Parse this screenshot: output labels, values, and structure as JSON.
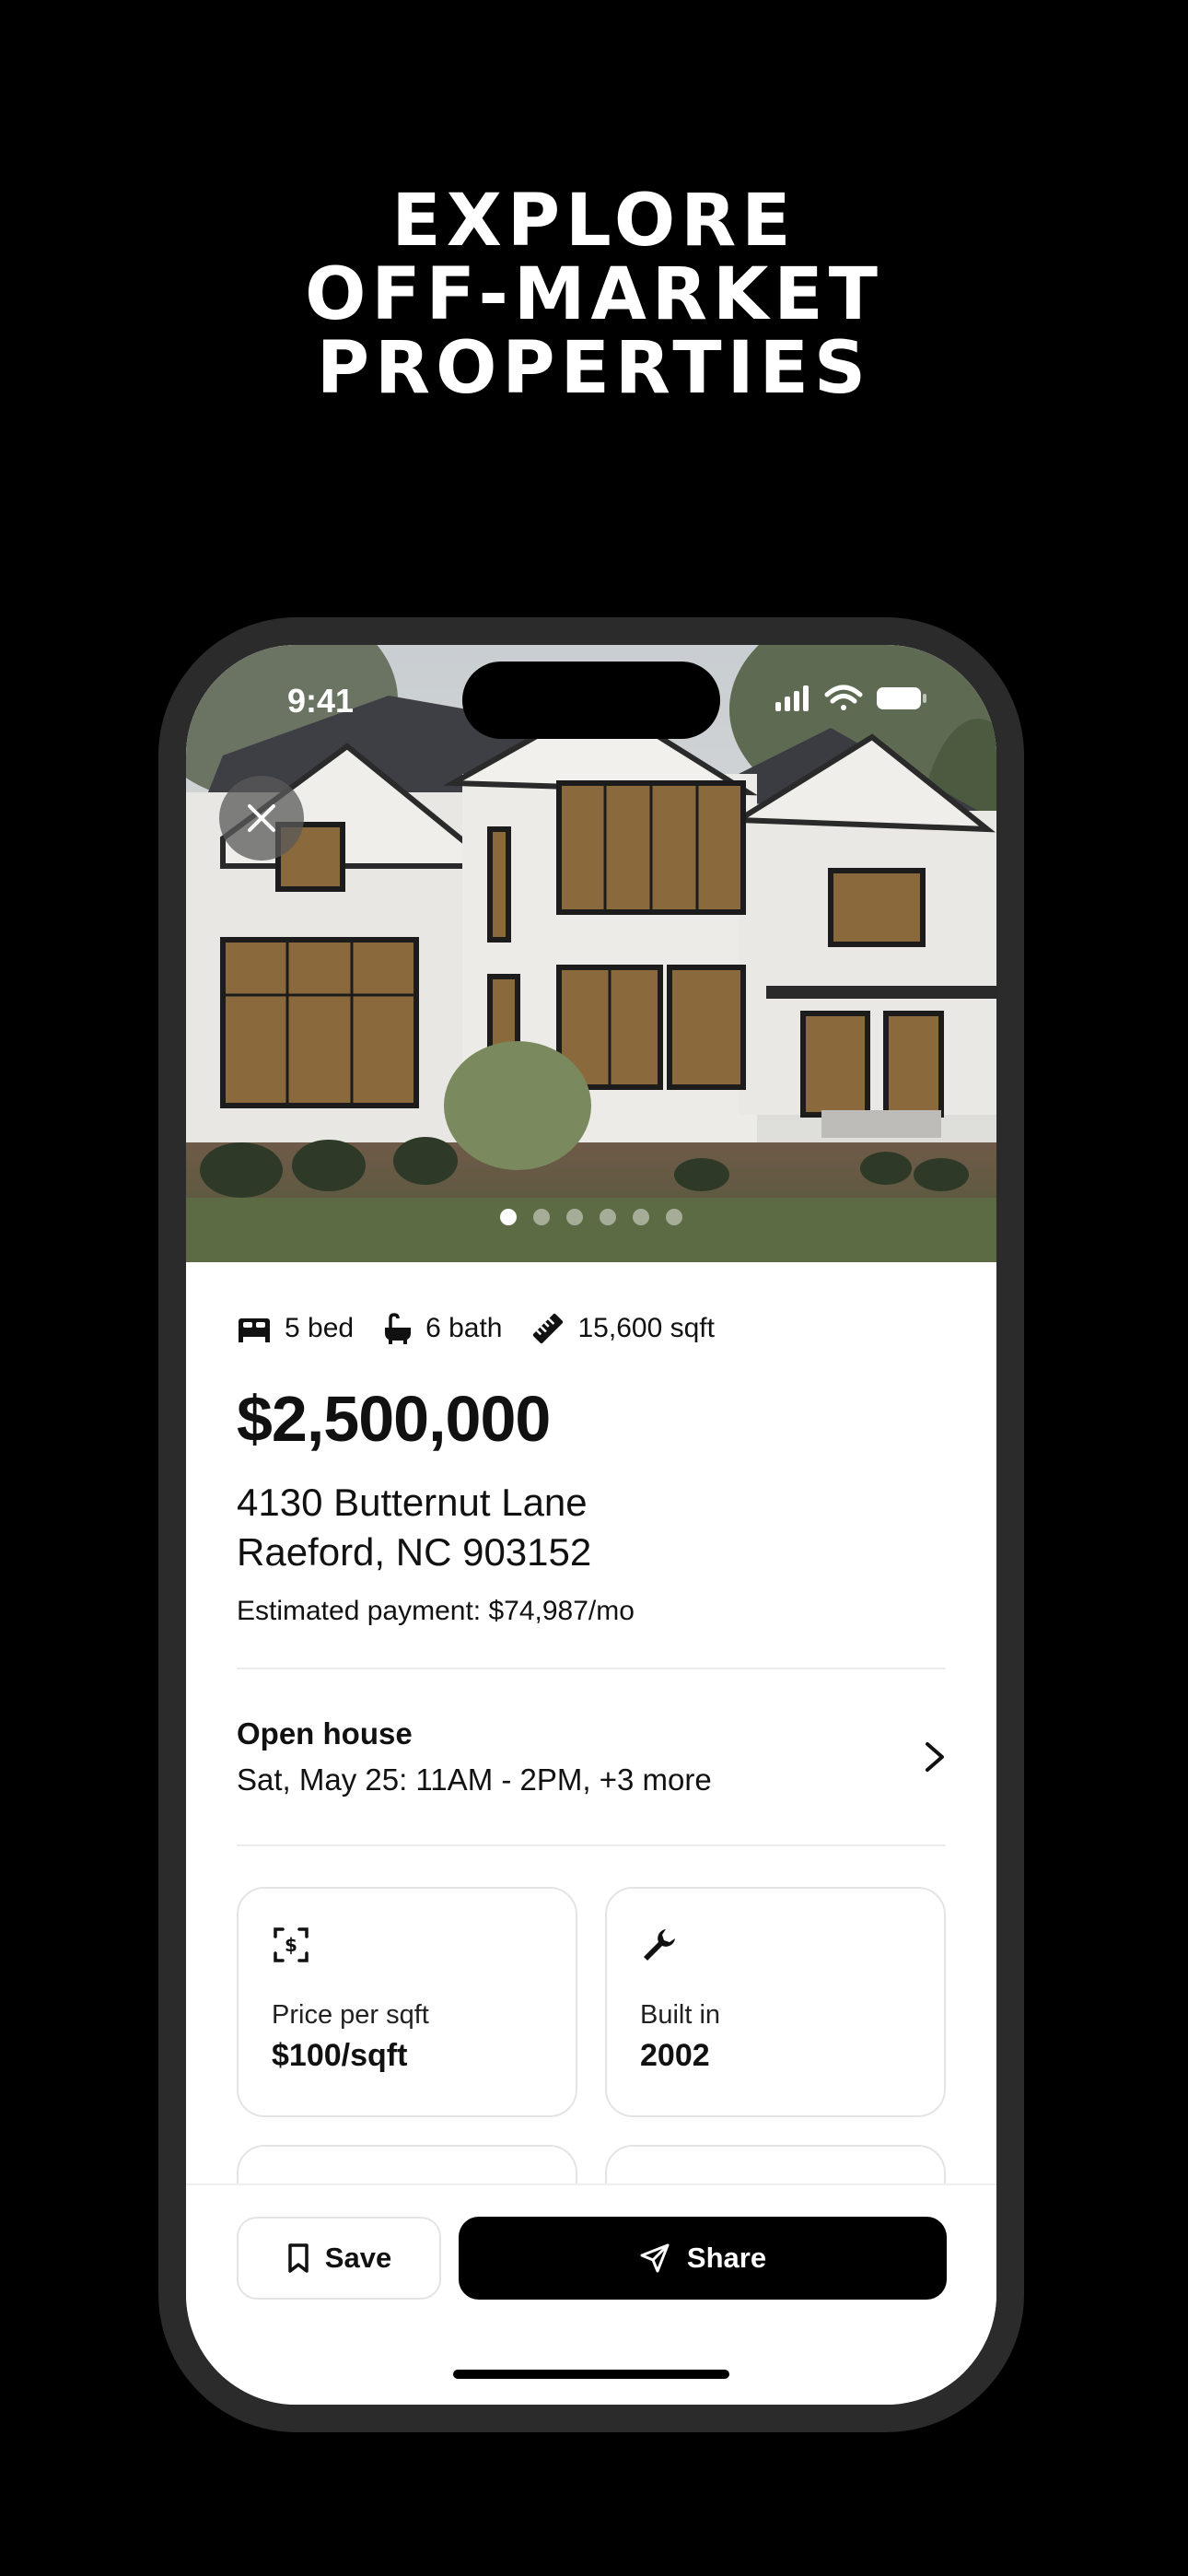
{
  "headline": {
    "line1": "EXPLORE",
    "line2": "OFF-MARKET",
    "line3": "PROPERTIES"
  },
  "status_bar": {
    "time": "9:41"
  },
  "gallery": {
    "photo_count": 6,
    "active_index": 0
  },
  "listing": {
    "beds": "5 bed",
    "baths": "6 bath",
    "sqft": "15,600 sqft",
    "price": "$2,500,000",
    "address_line1": "4130 Butternut Lane",
    "address_line2": "Raeford, NC 903152",
    "estimated_payment": "Estimated payment: $74,987/mo"
  },
  "open_house": {
    "title": "Open house",
    "schedule": "Sat, May 25: 11AM - 2PM, +3 more"
  },
  "facts": [
    {
      "icon": "price-tag-icon",
      "label": "Price per sqft",
      "value": "$100/sqft"
    },
    {
      "icon": "wrench-icon",
      "label": "Built in",
      "value": "2002"
    }
  ],
  "actions": {
    "save_label": "Save",
    "share_label": "Share"
  },
  "colors": {
    "background": "#000000",
    "primary_button": "#000000",
    "surface": "#ffffff"
  }
}
